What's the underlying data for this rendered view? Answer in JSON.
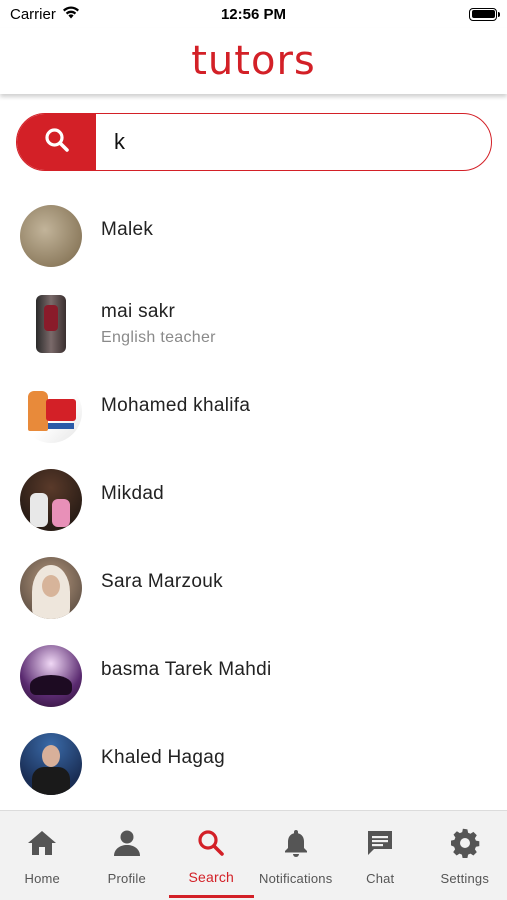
{
  "status_bar": {
    "carrier": "Carrier",
    "time": "12:56 PM"
  },
  "app": {
    "logo_text": "tutors",
    "accent_color": "#d32027"
  },
  "search": {
    "value": "k",
    "icon": "search-icon"
  },
  "results": [
    {
      "name": "Malek",
      "subtitle": ""
    },
    {
      "name": "mai sakr",
      "subtitle": "English teacher"
    },
    {
      "name": "Mohamed khalifa",
      "subtitle": ""
    },
    {
      "name": "Mikdad",
      "subtitle": ""
    },
    {
      "name": "Sara Marzouk",
      "subtitle": ""
    },
    {
      "name": "basma Tarek Mahdi",
      "subtitle": ""
    },
    {
      "name": "Khaled Hagag",
      "subtitle": ""
    }
  ],
  "bottom_nav": {
    "items": [
      {
        "label": "Home",
        "icon": "home-icon",
        "active": false
      },
      {
        "label": "Profile",
        "icon": "person-icon",
        "active": false
      },
      {
        "label": "Search",
        "icon": "search-icon",
        "active": true
      },
      {
        "label": "Notifications",
        "icon": "bell-icon",
        "active": false
      },
      {
        "label": "Chat",
        "icon": "chat-icon",
        "active": false
      },
      {
        "label": "Settings",
        "icon": "gear-icon",
        "active": false
      }
    ]
  }
}
